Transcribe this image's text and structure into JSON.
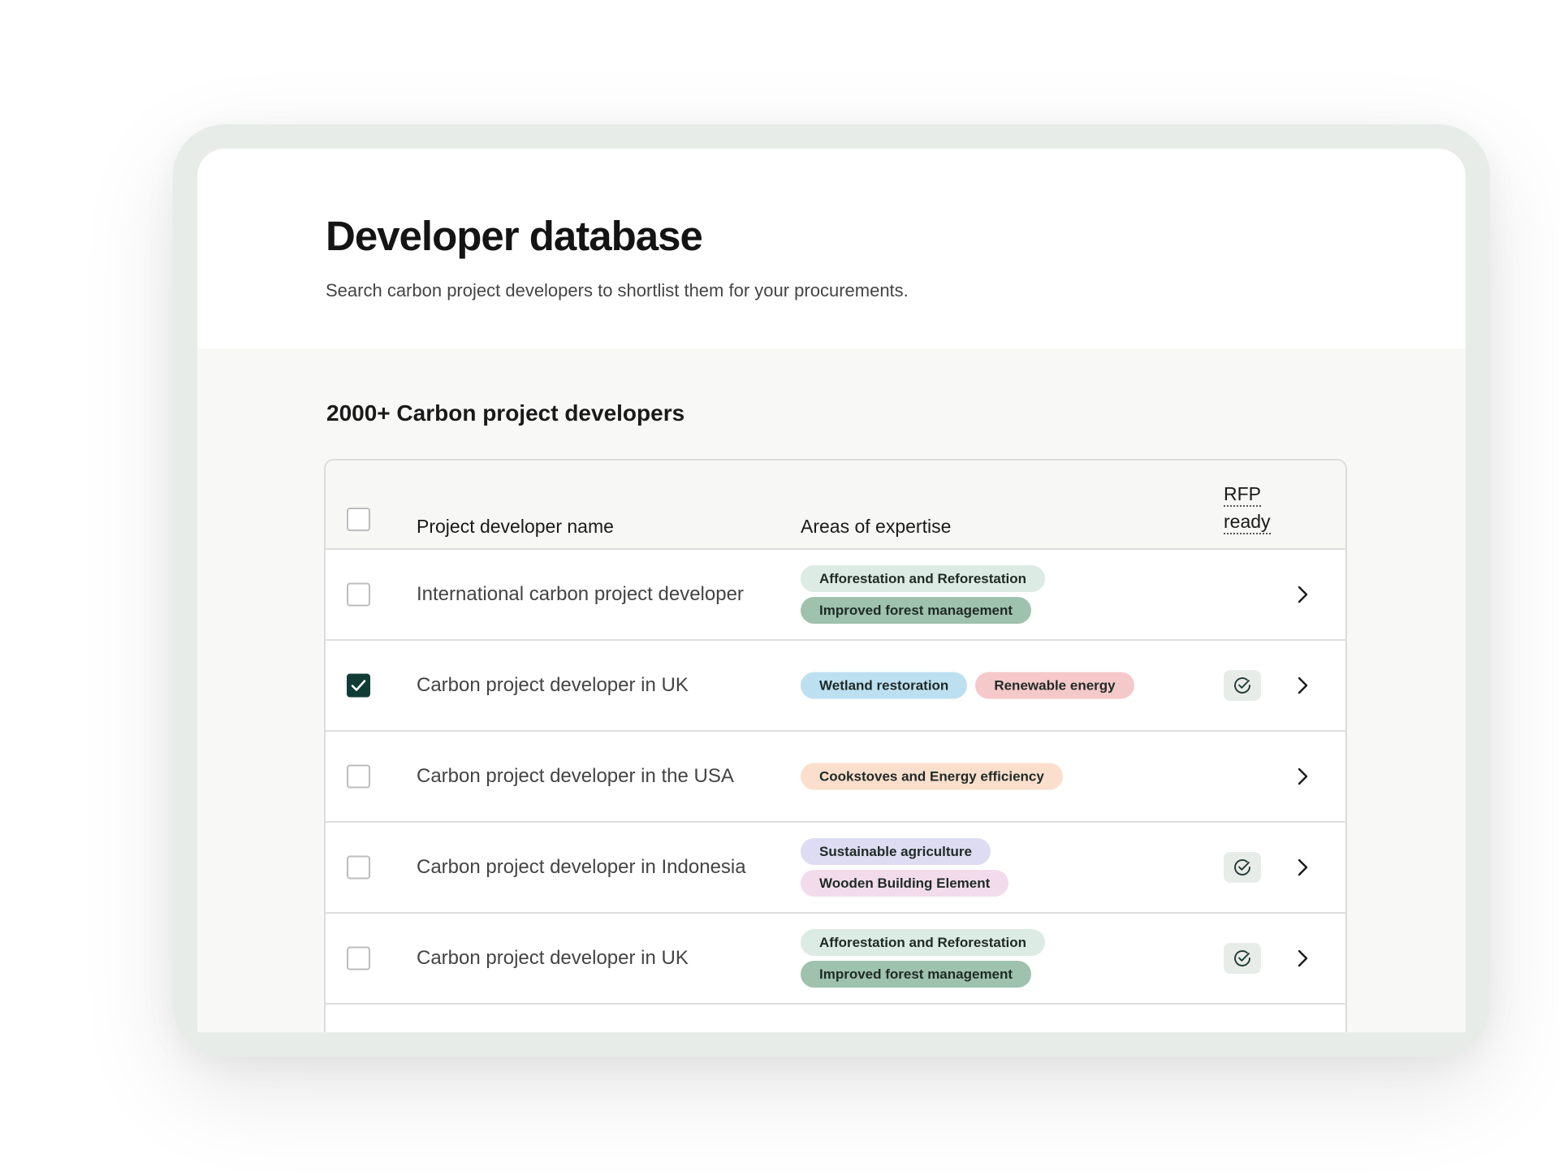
{
  "header": {
    "title": "Developer database",
    "subtitle": "Search carbon project developers to shortlist them for your procurements."
  },
  "section_title": "2000+ Carbon project developers",
  "table": {
    "columns": {
      "name": "Project developer name",
      "areas": "Areas of expertise",
      "rfp_line1": "RFP",
      "rfp_line2": "ready"
    },
    "rows": [
      {
        "name": "International carbon project developer",
        "checked": false,
        "rfp_ready": false,
        "tags": [
          {
            "label": "Afforestation and Reforestation",
            "color": "#dcebe3"
          },
          {
            "label": "Improved forest management",
            "color": "#9ec2ad"
          }
        ]
      },
      {
        "name": "Carbon project developer in UK",
        "checked": true,
        "rfp_ready": true,
        "tags": [
          {
            "label": "Wetland restoration",
            "color": "#bde0f1"
          },
          {
            "label": "Renewable energy",
            "color": "#f5c9c9"
          }
        ]
      },
      {
        "name": "Carbon project developer in the USA",
        "checked": false,
        "rfp_ready": false,
        "tags": [
          {
            "label": "Cookstoves and Energy efficiency",
            "color": "#fbdfcc"
          }
        ]
      },
      {
        "name": "Carbon project developer in Indonesia",
        "checked": false,
        "rfp_ready": true,
        "tags": [
          {
            "label": "Sustainable agriculture",
            "color": "#dddcf2"
          },
          {
            "label": "Wooden Building Element",
            "color": "#f2dcec"
          }
        ]
      },
      {
        "name": "Carbon project developer in UK",
        "checked": false,
        "rfp_ready": true,
        "tags": [
          {
            "label": "Afforestation and Reforestation",
            "color": "#dcebe3"
          },
          {
            "label": "Improved forest management",
            "color": "#9ec2ad"
          }
        ]
      }
    ]
  },
  "icons": {
    "row_action": "chevron-right-icon",
    "rfp": "check-circle-icon",
    "checkbox_checked": "checkmark-icon"
  },
  "colors": {
    "checked_checkbox": "#0f3d35",
    "device_frame": "#e7ece9",
    "rfp_badge_bg": "#e8ece9"
  }
}
